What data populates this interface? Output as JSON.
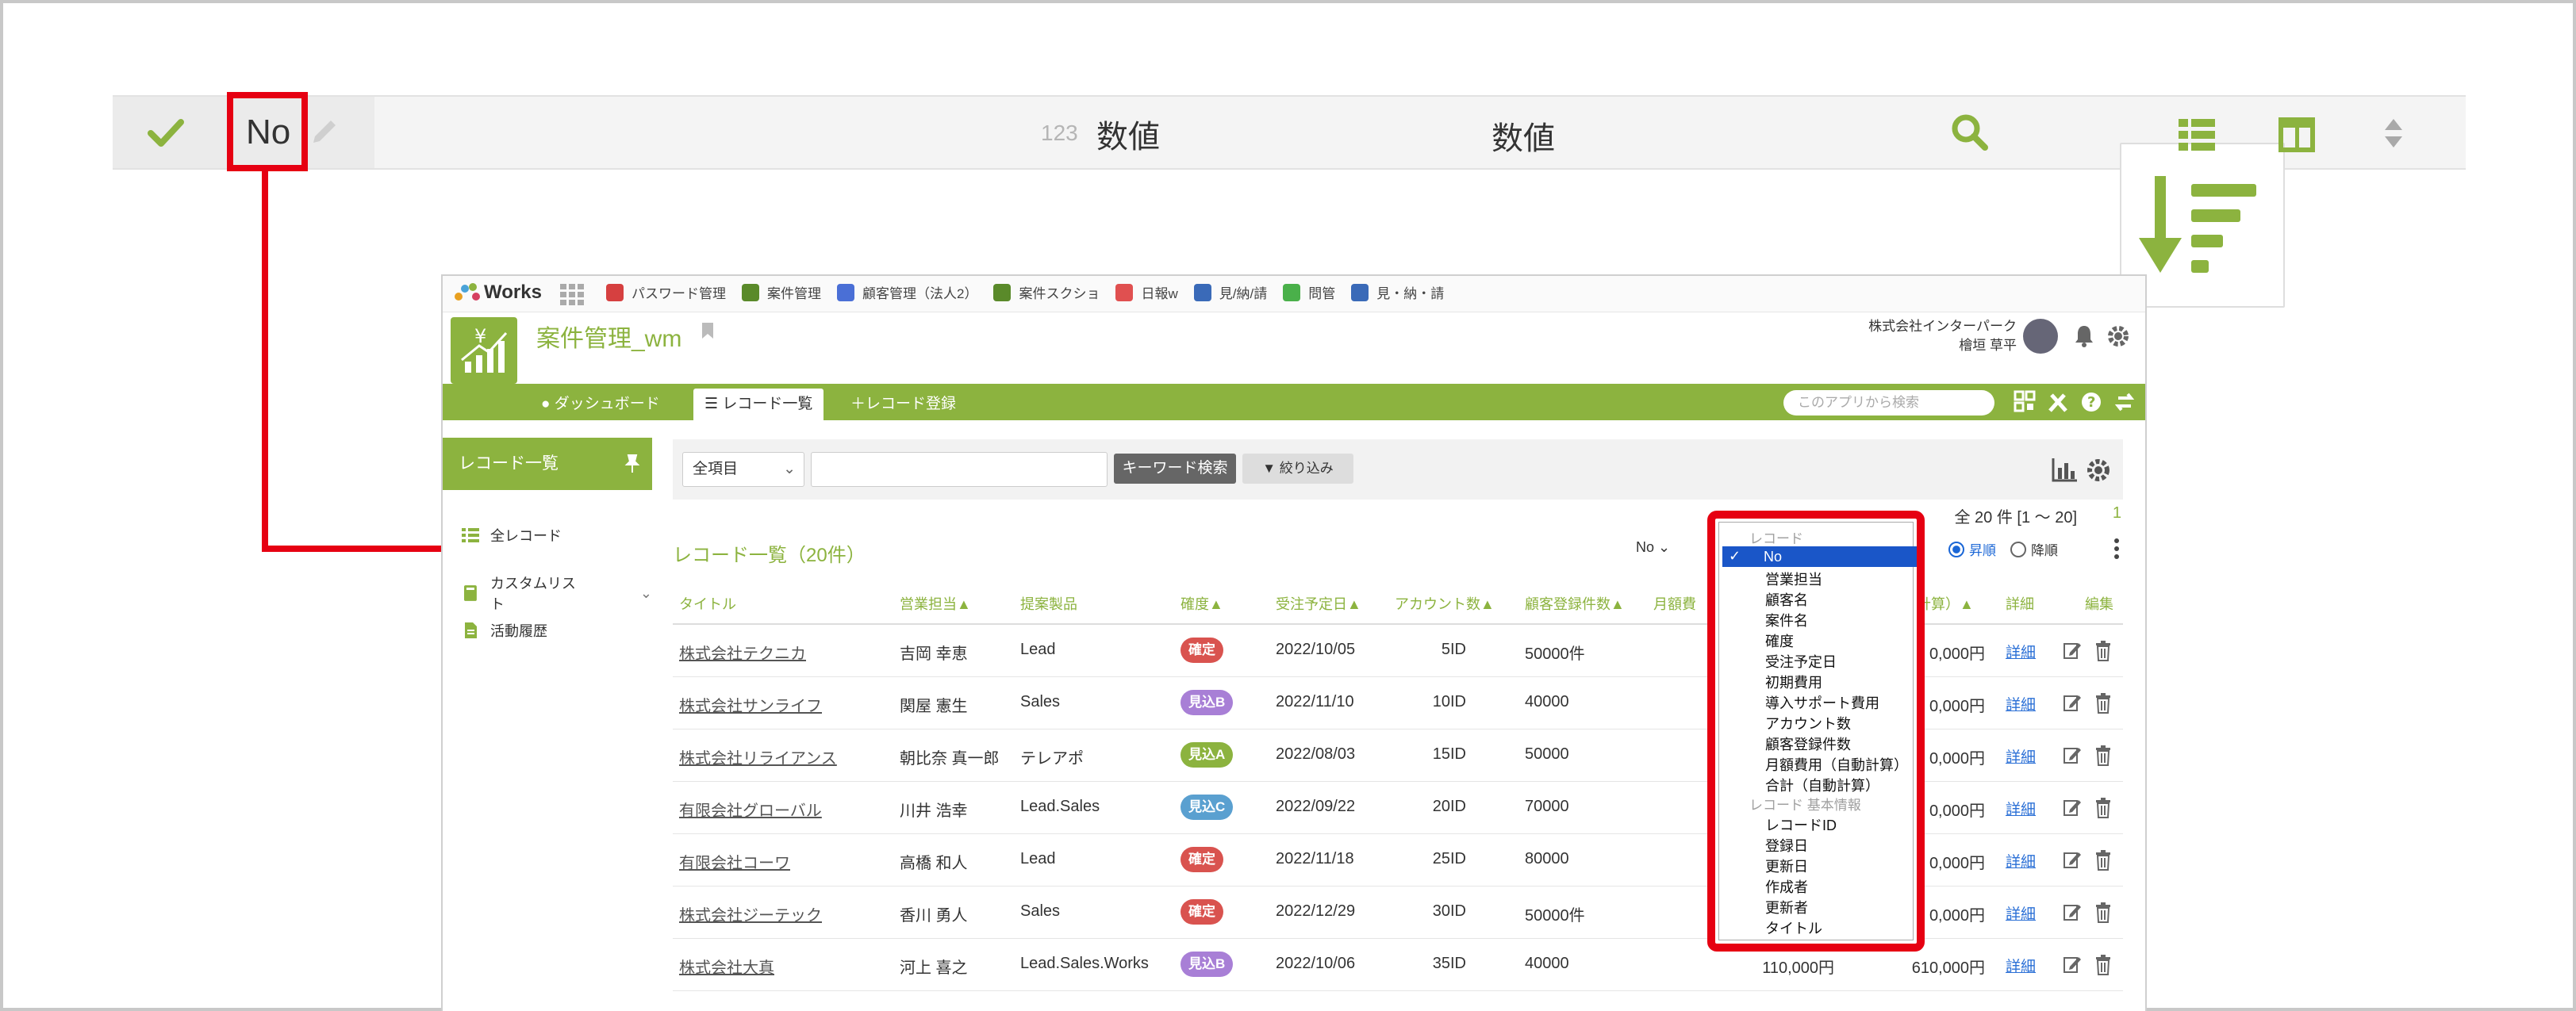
{
  "zoom_toolbar": {
    "field_name": "No",
    "type_icon_text": "123",
    "type_label_1": "数値",
    "type_label_2": "数値",
    "accent_color": "#8cb33f",
    "callout_color": "#e60012"
  },
  "topnav": {
    "logo_text": "Works",
    "apps": [
      {
        "label": "パスワード管理",
        "icon_color": "#d64040"
      },
      {
        "label": "案件管理",
        "icon_color": "#5a8a2a"
      },
      {
        "label": "顧客管理（法人2）",
        "icon_color": "#4a6fd6"
      },
      {
        "label": "案件スクショ",
        "icon_color": "#5a8a2a"
      },
      {
        "label": "日報w",
        "icon_color": "#e05050"
      },
      {
        "label": "見/納/請",
        "icon_color": "#3a6ab8"
      },
      {
        "label": "問管",
        "icon_color": "#4ab04a"
      },
      {
        "label": "見・納・請",
        "icon_color": "#3a6ab8"
      }
    ]
  },
  "header": {
    "app_title": "案件管理_wm",
    "company": "株式会社インターパーク",
    "user": "檜垣 草平"
  },
  "greenbar": {
    "tabs": [
      "ダッシュボード",
      "レコード一覧",
      "レコード登録"
    ],
    "search_placeholder": "このアプリから検索"
  },
  "sidebar": {
    "title": "レコード一覧",
    "items": [
      "全レコード",
      "カスタムリスト",
      "活動履歴"
    ]
  },
  "search": {
    "select_value": "全項目",
    "keyword_button": "キーワード検索",
    "filter_button": "絞り込み"
  },
  "list": {
    "title": "レコード一覧（20件）",
    "count": "全 20 件 [1 ～ 20]",
    "page": "1",
    "sort_asc": "昇順",
    "sort_desc": "降順",
    "sort_prefix": "No"
  },
  "table": {
    "headers": [
      "タイトル",
      "営業担当▲",
      "提案製品",
      "確度▲",
      "受注予定日▲",
      "アカウント数▲",
      "顧客登録件数▲",
      "月額費用",
      "合計（自動計算）▲",
      "詳細",
      "編集"
    ],
    "header_visible": [
      "タイトル",
      "営業担当▲",
      "提案製品",
      "確度▲",
      "受注予定日▲",
      "アカウント数▲",
      "顧客登録件数▲",
      "月額費",
      "計算）▲",
      "詳細",
      "編集"
    ],
    "rows": [
      {
        "title": "株式会社テクニカ",
        "sales": "吉岡 幸恵",
        "product": "Lead",
        "rank": "確定",
        "rank_color": "#d9534f",
        "date": "2022/10/05",
        "accounts": "5ID",
        "customers": "50000件",
        "monthly": "",
        "total": "0,000円",
        "detail": "詳細"
      },
      {
        "title": "株式会社サンライフ",
        "sales": "関屋 憲生",
        "product": "Sales",
        "rank": "見込B",
        "rank_color": "#a87fd6",
        "date": "2022/11/10",
        "accounts": "10ID",
        "customers": "40000",
        "monthly": "",
        "total": "0,000円",
        "detail": "詳細"
      },
      {
        "title": "株式会社リライアンス",
        "sales": "朝比奈 真一郎",
        "product": "テレアポ",
        "rank": "見込A",
        "rank_color": "#8cb33f",
        "date": "2022/08/03",
        "accounts": "15ID",
        "customers": "50000",
        "monthly": "",
        "total": "0,000円",
        "detail": "詳細"
      },
      {
        "title": "有限会社グローバル",
        "sales": "川井 浩幸",
        "product": "Lead.Sales",
        "rank": "見込C",
        "rank_color": "#5aa0d0",
        "date": "2022/09/22",
        "accounts": "20ID",
        "customers": "70000",
        "monthly": "",
        "total": "0,000円",
        "detail": "詳細"
      },
      {
        "title": "有限会社コーワ",
        "sales": "高橋 和人",
        "product": "Lead",
        "rank": "確定",
        "rank_color": "#d9534f",
        "date": "2022/11/18",
        "accounts": "25ID",
        "customers": "80000",
        "monthly": "",
        "total": "0,000円",
        "detail": "詳細"
      },
      {
        "title": "株式会社ジーテック",
        "sales": "香川 勇人",
        "product": "Sales",
        "rank": "確定",
        "rank_color": "#d9534f",
        "date": "2022/12/29",
        "accounts": "30ID",
        "customers": "50000件",
        "monthly": "",
        "total": "0,000円",
        "detail": "詳細"
      },
      {
        "title": "株式会社大真",
        "sales": "河上 喜之",
        "product": "Lead.Sales.Works",
        "rank": "見込B",
        "rank_color": "#a87fd6",
        "date": "2022/10/06",
        "accounts": "35ID",
        "customers": "40000",
        "monthly": "110,000円",
        "total": "610,000円",
        "detail": "詳細"
      }
    ]
  },
  "dropdown": {
    "group1": "レコード",
    "selected": "No",
    "items1": [
      "営業担当",
      "顧客名",
      "案件名",
      "確度",
      "受注予定日",
      "初期費用",
      "導入サポート費用",
      "アカウント数",
      "顧客登録件数",
      "月額費用（自動計算）",
      "合計（自動計算）"
    ],
    "group2": "レコード 基本情報",
    "items2": [
      "レコードID",
      "登録日",
      "更新日",
      "作成者",
      "更新者",
      "タイトル"
    ]
  }
}
